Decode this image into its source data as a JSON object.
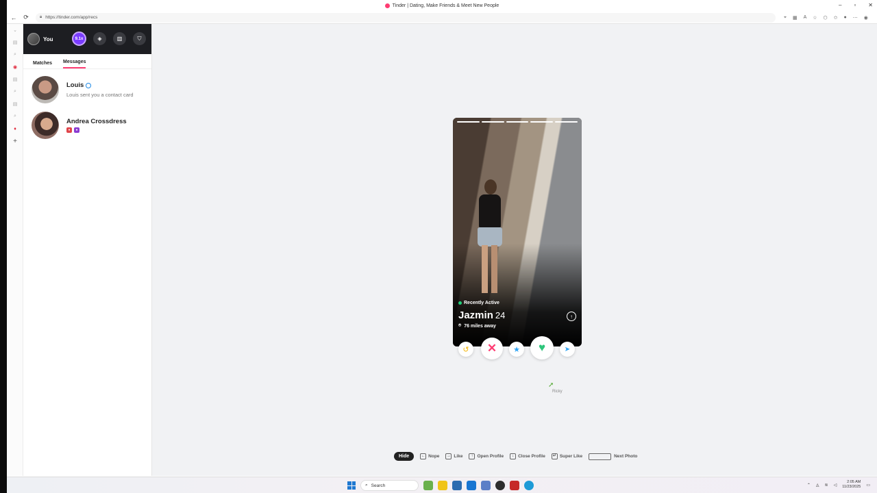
{
  "window": {
    "title": "Tinder | Dating, Make Friends & Meet New People",
    "url": "https://tinder.com/app/recs",
    "controls": [
      "–",
      "▫",
      "✕"
    ]
  },
  "sidebar": {
    "user_label": "You",
    "boost_label": "9.1x",
    "tabs": [
      {
        "label": "Matches"
      },
      {
        "label": "Messages",
        "active": true
      }
    ],
    "messages": [
      {
        "name": "Louis",
        "preview": "Louis sent you a contact card",
        "verified": true
      },
      {
        "name": "Andrea Crossdress",
        "preview": ""
      }
    ]
  },
  "card": {
    "status": "Recently Active",
    "name": "Jazmin",
    "age": "24",
    "distance": "76 miles away",
    "photo_count": 5,
    "current_photo": 1
  },
  "actions": {
    "rewind_icon": "↺",
    "nope_icon": "✕",
    "super_like_icon": "★",
    "like_icon": "♥",
    "boost_icon": "➤"
  },
  "cursor_label": "Ricky",
  "hints": {
    "hide": "Hide",
    "nope": "Nope",
    "like": "Like",
    "open_profile": "Open Profile",
    "close_profile": "Close Profile",
    "super_like": "Super Like",
    "next_photo": "Next Photo"
  },
  "taskbar": {
    "search_placeholder": "Search",
    "time": "2:05 AM",
    "date": "11/23/2025"
  },
  "colors": {
    "brand": "#fe3c72",
    "like": "#2ec57b",
    "super_like": "#2ea4f5",
    "rewind": "#f5b400",
    "boost": "#7a3cff"
  }
}
